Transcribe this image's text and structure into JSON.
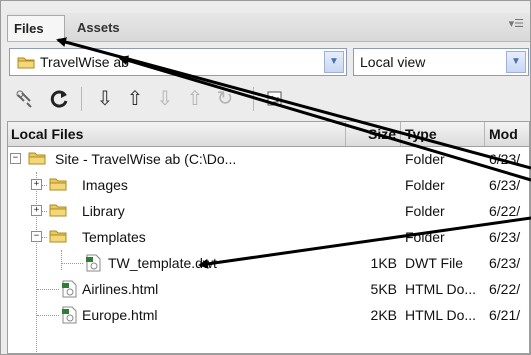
{
  "tabs": [
    {
      "label": "Files",
      "active": true
    },
    {
      "label": "Assets",
      "active": false
    }
  ],
  "tab_menu_icon": "panel-options-icon",
  "site_select": {
    "value": "TravelWise ab",
    "icon": "folder-icon"
  },
  "view_select": {
    "value": "Local view"
  },
  "toolbar": {
    "buttons": [
      "connect-icon",
      "refresh-icon",
      "get-files-icon",
      "put-files-icon",
      "check-out-icon",
      "check-in-icon",
      "synchronize-icon",
      "expand-icon"
    ]
  },
  "columns": {
    "name": "Local Files",
    "size": "Size",
    "type": "Type",
    "modified": "Mod"
  },
  "rows": [
    {
      "name": "Site - TravelWise ab (C:\\Do...",
      "size": "",
      "type": "Folder",
      "modified": "6/23/",
      "kind": "folder",
      "level": 0,
      "expander": "minus"
    },
    {
      "name": "Images",
      "size": "",
      "type": "Folder",
      "modified": "6/23/",
      "kind": "folder",
      "level": 1,
      "expander": "plus"
    },
    {
      "name": "Library",
      "size": "",
      "type": "Folder",
      "modified": "6/22/",
      "kind": "folder",
      "level": 1,
      "expander": "plus"
    },
    {
      "name": "Templates",
      "size": "",
      "type": "Folder",
      "modified": "6/23/",
      "kind": "folder",
      "level": 1,
      "expander": "minus"
    },
    {
      "name": "TW_template.dwt",
      "size": "1KB",
      "type": "DWT File",
      "modified": "6/23/",
      "kind": "file",
      "level": 2,
      "expander": ""
    },
    {
      "name": "Airlines.html",
      "size": "5KB",
      "type": "HTML Do...",
      "modified": "6/22/",
      "kind": "file",
      "level": 1,
      "expander": ""
    },
    {
      "name": "Europe.html",
      "size": "2KB",
      "type": "HTML Do...",
      "modified": "6/21/",
      "kind": "file",
      "level": 1,
      "expander": ""
    }
  ],
  "colors": {
    "folder": "#e8c860",
    "folder_border": "#b08a20",
    "arrow": "#000000",
    "file_green": "#2e7d32"
  }
}
